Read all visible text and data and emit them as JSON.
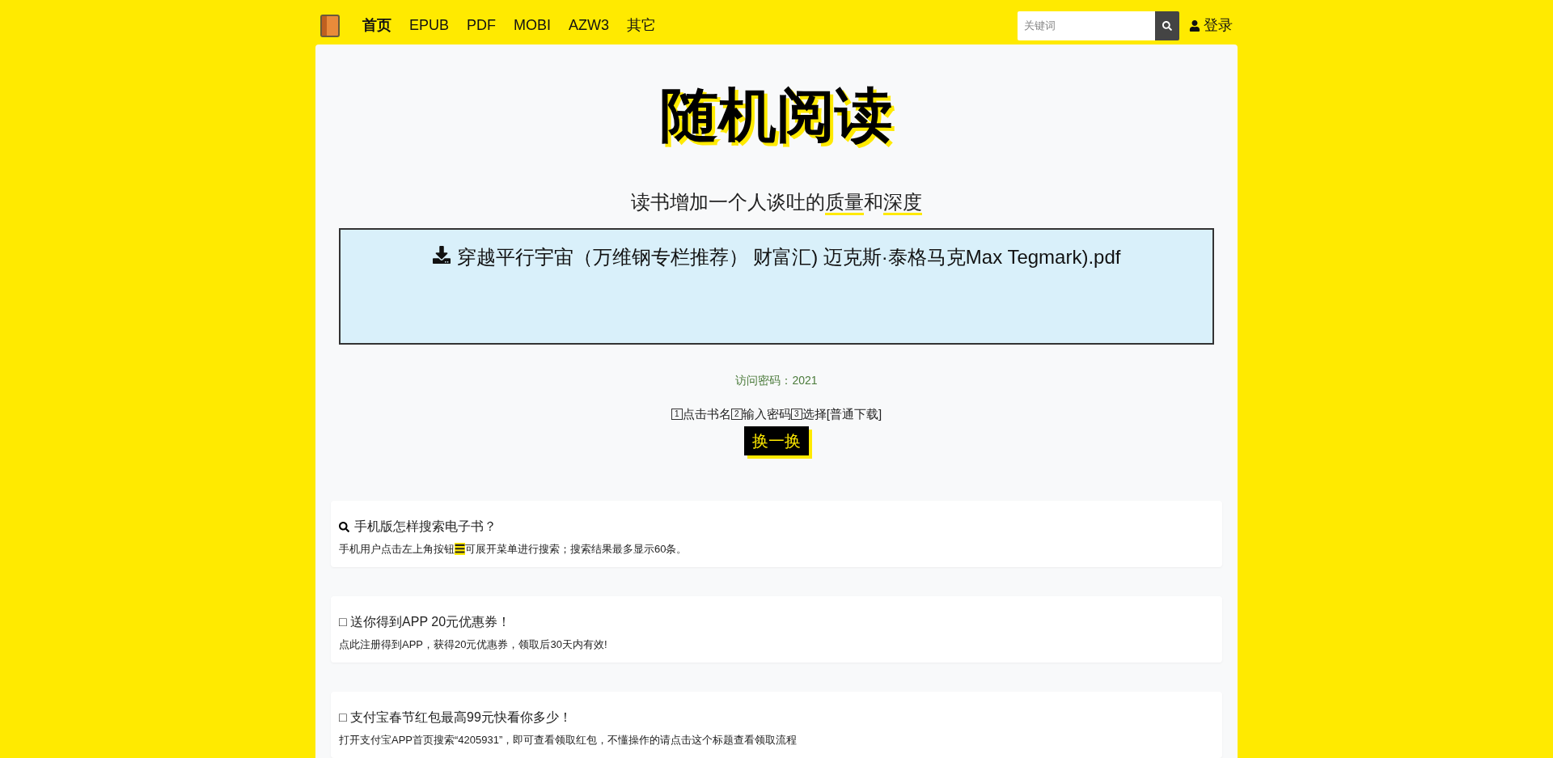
{
  "nav": {
    "items": [
      {
        "label": "首页",
        "selected": true
      },
      {
        "label": "EPUB",
        "selected": false
      },
      {
        "label": "PDF",
        "selected": false
      },
      {
        "label": "MOBI",
        "selected": false
      },
      {
        "label": "AZW3",
        "selected": false
      },
      {
        "label": "其它",
        "selected": false
      }
    ],
    "search": {
      "placeholder": "关键词"
    },
    "login": "登录"
  },
  "hero": {
    "title": "随机阅读",
    "subtitle": [
      {
        "text": "读书增加一个人谈吐的",
        "underline": false
      },
      {
        "text": "质量",
        "underline": true
      },
      {
        "text": "和",
        "underline": false
      },
      {
        "text": "深度",
        "underline": true
      }
    ]
  },
  "book": {
    "title": "穿越平行宇宙（万维钢专栏推荐） 财富汇) 迈克斯·泰格马克Max Tegmark).pdf"
  },
  "password": "访问密码：2021",
  "steps": [
    {
      "num": "1",
      "text": "点击书名"
    },
    {
      "num": "2",
      "text": "输入密码"
    },
    {
      "num": "3",
      "text": "选择[普通下载]"
    }
  ],
  "shuffle_button": "换一换",
  "notices": [
    {
      "kind": "search",
      "title": "手机版怎样搜索电子书？",
      "desc": [
        {
          "text": "手机用户点击左上角按钮",
          "highlight": false
        },
        {
          "text": "☰",
          "highlight": true
        },
        {
          "text": "可展开菜单进行搜索；搜索结果最多显示60条。",
          "highlight": false
        }
      ]
    },
    {
      "kind": "plain",
      "title": "□ 送你得到APP 20元优惠券！",
      "desc": [
        {
          "text": "点此注册得到APP，获得20元优惠券，领取后30天内有效!",
          "highlight": false
        }
      ]
    },
    {
      "kind": "plain",
      "title": "□ 支付宝春节红包最高99元快看你多少！",
      "desc": [
        {
          "text": "打开支付宝APP首页搜索“4205931”，即可查看领取红包，不懂操作的请点击这个标题查看领取流程",
          "highlight": false
        }
      ]
    }
  ]
}
